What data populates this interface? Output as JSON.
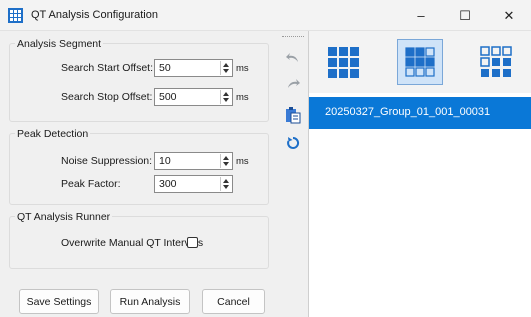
{
  "window": {
    "title": "QT Analysis Configuration",
    "minimize_glyph": "–",
    "maximize_glyph": "☐",
    "close_glyph": "✕"
  },
  "analysis_segment": {
    "title": "Analysis Segment",
    "start_label": "Search Start Offset:",
    "start_value": "50",
    "start_unit": "ms",
    "stop_label": "Search Stop Offset:",
    "stop_value": "500",
    "stop_unit": "ms"
  },
  "peak_detection": {
    "title": "Peak Detection",
    "noise_label": "Noise Suppression:",
    "noise_value": "10",
    "noise_unit": "ms",
    "factor_label": "Peak Factor:",
    "factor_value": "300"
  },
  "runner": {
    "title": "QT Analysis Runner",
    "overwrite_label": "Overwrite Manual QT Intervals",
    "overwrite_checked": false
  },
  "buttons": {
    "save": "Save Settings",
    "run": "Run Analysis",
    "cancel": "Cancel"
  },
  "toolbar": {
    "icons": [
      "undo-icon",
      "redo-icon",
      "paste-icon",
      "refresh-icon"
    ]
  },
  "right_panel": {
    "view_options": [
      "large-grid-view",
      "medium-grid-view",
      "small-grid-view"
    ],
    "selected_view": "medium-grid-view",
    "accent": "#0a78d7",
    "items": [
      "20250327_Group_01_001_00031"
    ]
  }
}
